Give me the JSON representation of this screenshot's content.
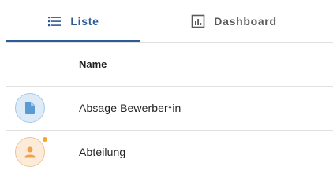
{
  "tabs": [
    {
      "label": "Liste",
      "icon": "list-icon",
      "active": true
    },
    {
      "label": "Dashboard",
      "icon": "dashboard-icon",
      "active": false
    }
  ],
  "table": {
    "columns": [
      "Name"
    ],
    "rows": [
      {
        "name": "Absage Bewerber*in",
        "icon": "document-icon",
        "has_notification": false
      },
      {
        "name": "Abteilung",
        "icon": "person-icon",
        "has_notification": true
      }
    ]
  },
  "colors": {
    "accent": "#2d5b96",
    "doc_icon": "#5b9bd5",
    "person_icon": "#f0a24a",
    "notification_dot": "#f5a623"
  }
}
